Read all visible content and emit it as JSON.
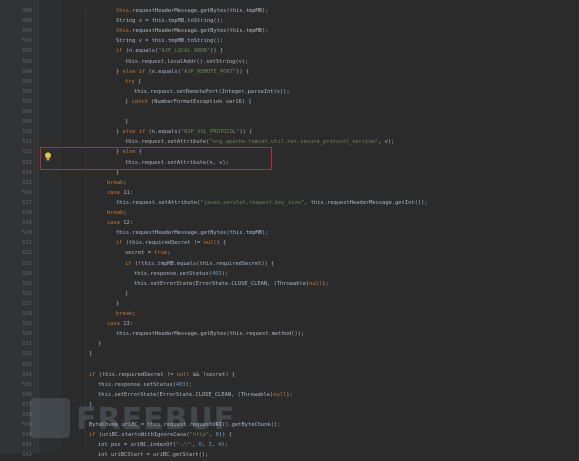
{
  "lines": [
    {
      "ln": "498",
      "indent": [
        3,
        "fld"
      ],
      "tokens": [
        [
          "this",
          "kw"
        ],
        [
          ".requestHeaderMessage.getBytes(this.tmpMB);",
          ""
        ]
      ]
    },
    {
      "ln": "499",
      "tokens": [
        [
          "String v = this.tmpMB.toString();",
          ""
        ]
      ]
    },
    {
      "ln": "500",
      "tokens": [
        [
          "this",
          "kw"
        ],
        [
          ".requestHeaderMessage.getBytes(this.tmpMB);",
          ""
        ]
      ]
    },
    {
      "ln": "501",
      "tokens": [
        [
          "String v = this.tmpMB.toString();",
          ""
        ]
      ]
    },
    {
      "ln": "502",
      "tokens": [
        [
          "if",
          "kw"
        ],
        [
          " (n.equals(",
          ""
        ],
        [
          "\"AJP_LOCAL_ADDR\"",
          "str"
        ],
        [
          ")) {",
          ""
        ]
      ]
    },
    {
      "ln": "503",
      "tokens": [
        [
          "this.request.localAddr().setString(v);",
          ""
        ]
      ]
    },
    {
      "ln": "504",
      "tokens": [
        [
          "} ",
          ""
        ],
        [
          "else if",
          "kw"
        ],
        [
          " (n.equals(",
          ""
        ],
        [
          "\"AJP_REMOTE_PORT\"",
          "str"
        ],
        [
          ")) {",
          ""
        ]
      ]
    },
    {
      "ln": "505",
      "tokens": [
        [
          "try",
          "kw"
        ],
        [
          " {",
          ""
        ]
      ]
    },
    {
      "ln": "506",
      "tokens": [
        [
          "this.request.setRemotePort(Integer.parseInt(v));",
          ""
        ]
      ]
    },
    {
      "ln": "507",
      "tokens": [
        [
          "} ",
          ""
        ],
        [
          "catch",
          "kw"
        ],
        [
          " (NumberFormatException var16) {",
          ""
        ]
      ]
    },
    {
      "ln": "508",
      "tokens": [
        [
          "",
          ""
        ]
      ]
    },
    {
      "ln": "509",
      "tokens": [
        [
          "}",
          ""
        ]
      ]
    },
    {
      "ln": "510",
      "tokens": [
        [
          "} ",
          ""
        ],
        [
          "else if",
          "kw"
        ],
        [
          " (n.equals(",
          ""
        ],
        [
          "\"AJP_SSL_PROTOCOL\"",
          "str"
        ],
        [
          ")) {",
          ""
        ]
      ]
    },
    {
      "ln": "511",
      "tokens": [
        [
          "this.request.setAttribute(",
          ""
        ],
        [
          "\"org.apache.tomcat.util.net.secure_protocol_version\"",
          "str"
        ],
        [
          ", v);",
          ""
        ]
      ]
    },
    {
      "ln": "512",
      "tokens": [
        [
          "} ",
          ""
        ],
        [
          "else",
          "kw"
        ],
        [
          " {",
          ""
        ]
      ]
    },
    {
      "ln": "513",
      "tokens": [
        [
          "this.request.setAttribute(n, v);",
          ""
        ]
      ]
    },
    {
      "ln": "514",
      "tokens": [
        [
          "}",
          ""
        ]
      ]
    },
    {
      "ln": "515",
      "tokens": [
        [
          "break",
          "kw"
        ],
        [
          ";",
          ""
        ]
      ]
    },
    {
      "ln": "516",
      "tokens": [
        [
          "case",
          "kw"
        ],
        [
          " 11:",
          ""
        ]
      ]
    },
    {
      "ln": "517",
      "tokens": [
        [
          "this.request.setAttribute(",
          ""
        ],
        [
          "\"javax.servlet.request.key_size\"",
          "str"
        ],
        [
          ", this.requestHeaderMessage.getInt());",
          ""
        ]
      ]
    },
    {
      "ln": "518",
      "tokens": [
        [
          "break",
          "kw"
        ],
        [
          ";",
          ""
        ]
      ]
    },
    {
      "ln": "519",
      "tokens": [
        [
          "case",
          "kw"
        ],
        [
          " 12:",
          ""
        ]
      ]
    },
    {
      "ln": "520",
      "tokens": [
        [
          "this.requestHeaderMessage.getBytes(this.tmpMB);",
          ""
        ]
      ]
    },
    {
      "ln": "521",
      "tokens": [
        [
          "if",
          "kw"
        ],
        [
          " (this.requiredSecret != ",
          ""
        ],
        [
          "null",
          "kw"
        ],
        [
          ") {",
          ""
        ]
      ]
    },
    {
      "ln": "522",
      "tokens": [
        [
          "secret = ",
          ""
        ],
        [
          "true",
          "kw"
        ],
        [
          ";",
          ""
        ]
      ]
    },
    {
      "ln": "523",
      "tokens": [
        [
          "if",
          "kw"
        ],
        [
          " (!this.tmpMB.equals(this.requiredSecret)) {",
          ""
        ]
      ]
    },
    {
      "ln": "524",
      "tokens": [
        [
          "this.response.setStatus(",
          ""
        ],
        [
          "403",
          "num"
        ],
        [
          ");",
          ""
        ]
      ]
    },
    {
      "ln": "525",
      "tokens": [
        [
          "this.setErrorState(ErrorState.CLOSE_CLEAN, (Throwable)",
          ""
        ],
        [
          "null",
          "kw"
        ],
        [
          ");",
          ""
        ]
      ]
    },
    {
      "ln": "526",
      "tokens": [
        [
          "}",
          ""
        ]
      ]
    },
    {
      "ln": "527",
      "tokens": [
        [
          "}",
          ""
        ]
      ]
    },
    {
      "ln": "528",
      "tokens": [
        [
          "break",
          "kw"
        ],
        [
          ";",
          ""
        ]
      ]
    },
    {
      "ln": "529",
      "tokens": [
        [
          "case",
          "kw"
        ],
        [
          " 13:",
          ""
        ]
      ]
    },
    {
      "ln": "530",
      "tokens": [
        [
          "this.requestHeaderMessage.getBytes(this.request.method());",
          ""
        ]
      ]
    },
    {
      "ln": "531",
      "tokens": [
        [
          "}",
          ""
        ]
      ]
    },
    {
      "ln": "532",
      "tokens": [
        [
          "}",
          ""
        ]
      ]
    },
    {
      "ln": "533",
      "tokens": [
        [
          "",
          ""
        ]
      ]
    },
    {
      "ln": "534",
      "tokens": [
        [
          "if",
          "kw"
        ],
        [
          " (this.requiredSecret != ",
          ""
        ],
        [
          "null",
          "kw"
        ],
        [
          " && !secret) {",
          ""
        ]
      ]
    },
    {
      "ln": "535",
      "tokens": [
        [
          "this.response.setStatus(",
          ""
        ],
        [
          "403",
          "num"
        ],
        [
          ");",
          ""
        ]
      ]
    },
    {
      "ln": "536",
      "tokens": [
        [
          "this.setErrorState(ErrorState.CLOSE_CLEAN, (Throwable)",
          ""
        ],
        [
          "null",
          "kw"
        ],
        [
          ");",
          ""
        ]
      ]
    },
    {
      "ln": "537",
      "tokens": [
        [
          "}",
          ""
        ]
      ]
    },
    {
      "ln": "538",
      "tokens": [
        [
          "",
          ""
        ]
      ]
    },
    {
      "ln": "539",
      "tokens": [
        [
          "ByteChunk uriBC = this.request.requestURI().getByteChunk();",
          ""
        ]
      ]
    },
    {
      "ln": "540",
      "tokens": [
        [
          "if",
          "kw"
        ],
        [
          " (uriBC.startsWithIgnoreCase(",
          ""
        ],
        [
          "\"http\"",
          "str"
        ],
        [
          ", ",
          ""
        ],
        [
          "0",
          "num"
        ],
        [
          ")) {",
          ""
        ]
      ]
    },
    {
      "ln": "541",
      "tokens": [
        [
          "int pos = uriBC.indexOf(",
          ""
        ],
        [
          "\"://\"",
          "str"
        ],
        [
          ", ",
          ""
        ],
        [
          "0",
          "num"
        ],
        [
          ", ",
          ""
        ],
        [
          "3",
          "num"
        ],
        [
          ", ",
          ""
        ],
        [
          "4",
          "num"
        ],
        [
          ");",
          ""
        ]
      ]
    },
    {
      "ln": "542",
      "tokens": [
        [
          "int uriBCStart = uriBC.getStart();",
          ""
        ]
      ]
    }
  ],
  "watermark": {
    "text": "FREEBUF"
  },
  "colors": {
    "background": "#2b2b2b",
    "gutter": "#313335",
    "highlight": "#c4262e",
    "keyword": "#cc7832",
    "string": "#6a8759",
    "number": "#6897bb",
    "text": "#a9b7c6"
  },
  "icons": {
    "bulb": "lightbulb-icon"
  }
}
